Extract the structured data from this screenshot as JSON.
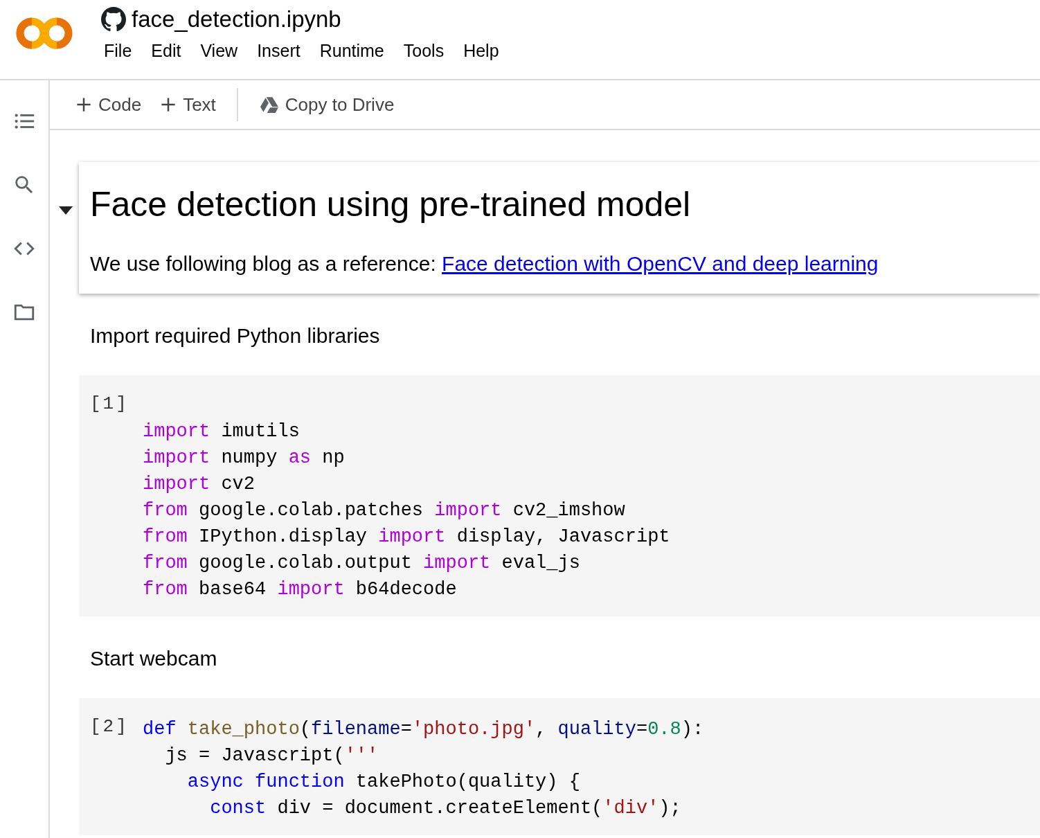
{
  "notebook": {
    "title": "face_detection.ipynb"
  },
  "menu": [
    "File",
    "Edit",
    "View",
    "Insert",
    "Runtime",
    "Tools",
    "Help"
  ],
  "toolbar": [
    {
      "kind": "add",
      "label": "Code"
    },
    {
      "kind": "add",
      "label": "Text"
    },
    {
      "kind": "drive",
      "label": "Copy to Drive"
    }
  ],
  "sidebar": [
    {
      "kind": "toc"
    },
    {
      "kind": "search"
    },
    {
      "kind": "snippets"
    },
    {
      "kind": "files"
    }
  ],
  "cells": [
    {
      "kind": "heading",
      "selected": true,
      "expanded": true,
      "title": "Face detection using pre-trained model",
      "text": "We use following blog as a reference: ",
      "link": "Face detection with OpenCV and deep learning"
    },
    {
      "kind": "text",
      "text": "Import required Python libraries"
    },
    {
      "kind": "code",
      "label": "[1]",
      "label_own_line": true,
      "lines": [
        [
          {
            "kind": "keyword",
            "text": "import"
          },
          {
            "kind": "plain",
            "text": " imutils"
          }
        ],
        [
          {
            "kind": "keyword",
            "text": "import"
          },
          {
            "kind": "plain",
            "text": " numpy "
          },
          {
            "kind": "keyword",
            "text": "as"
          },
          {
            "kind": "plain",
            "text": " np"
          }
        ],
        [
          {
            "kind": "keyword",
            "text": "import"
          },
          {
            "kind": "plain",
            "text": " cv2"
          }
        ],
        [
          {
            "kind": "keyword",
            "text": "from"
          },
          {
            "kind": "plain",
            "text": " google.colab.patches "
          },
          {
            "kind": "keyword",
            "text": "import"
          },
          {
            "kind": "plain",
            "text": " cv2_imshow"
          }
        ],
        [
          {
            "kind": "keyword",
            "text": "from"
          },
          {
            "kind": "plain",
            "text": " IPython.display "
          },
          {
            "kind": "keyword",
            "text": "import"
          },
          {
            "kind": "plain",
            "text": " display, Javascript"
          }
        ],
        [
          {
            "kind": "keyword",
            "text": "from"
          },
          {
            "kind": "plain",
            "text": " google.colab.output "
          },
          {
            "kind": "keyword",
            "text": "import"
          },
          {
            "kind": "plain",
            "text": " eval_js"
          }
        ],
        [
          {
            "kind": "keyword",
            "text": "from"
          },
          {
            "kind": "plain",
            "text": " base64 "
          },
          {
            "kind": "keyword",
            "text": "import"
          },
          {
            "kind": "plain",
            "text": " b64decode"
          }
        ]
      ]
    },
    {
      "kind": "text",
      "text": "Start webcam"
    },
    {
      "kind": "code",
      "label": "[2]",
      "label_own_line": false,
      "lines": [
        [
          {
            "kind": "storage",
            "text": "def"
          },
          {
            "kind": "function",
            "text": " take_photo"
          },
          {
            "kind": "plain",
            "text": "("
          },
          {
            "kind": "param",
            "text": "filename"
          },
          {
            "kind": "plain",
            "text": "="
          },
          {
            "kind": "string",
            "text": "'photo.jpg'"
          },
          {
            "kind": "plain",
            "text": ", "
          },
          {
            "kind": "param",
            "text": "quality"
          },
          {
            "kind": "plain",
            "text": "="
          },
          {
            "kind": "number",
            "text": "0.8"
          },
          {
            "kind": "plain",
            "text": "):"
          }
        ],
        [
          {
            "kind": "plain",
            "text": "  js = Javascript("
          },
          {
            "kind": "string",
            "text": "'''"
          }
        ],
        [
          {
            "kind": "storage",
            "text": "    async"
          },
          {
            "kind": "storage",
            "text": " function"
          },
          {
            "kind": "plain",
            "text": " takePhoto(quality) {"
          }
        ],
        [
          {
            "kind": "storage",
            "text": "      const"
          },
          {
            "kind": "plain",
            "text": " div = document.createElement("
          },
          {
            "kind": "string",
            "text": "'div'"
          },
          {
            "kind": "plain",
            "text": ");"
          }
        ]
      ]
    }
  ]
}
